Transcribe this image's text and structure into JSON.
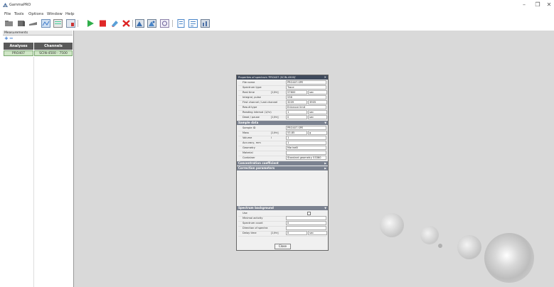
{
  "window": {
    "title": "GammaPRO",
    "controls": [
      "–",
      "❐",
      "✕"
    ]
  },
  "menu": [
    "File",
    "Tools",
    "Options",
    "Window",
    "Help"
  ],
  "toolbar": {
    "icons": [
      "open-folder-icon",
      "library-icon",
      "detector-icon",
      "spectrum-view-icon",
      "spectrum-list-icon",
      "spectrum-edit-icon",
      "start-icon",
      "stop-icon",
      "erase-icon",
      "delete-icon",
      "spectrum-a-icon",
      "spectrum-b-icon",
      "report-icon",
      "document-icon",
      "table-icon",
      "chart-icon"
    ],
    "colors": {
      "start": "#2fae4a",
      "stop": "#e02828",
      "delete": "#d22",
      "accent": "#3a78c9"
    }
  },
  "left_panel": {
    "header": "Measurements",
    "columns": [
      "Analyses",
      "Channels"
    ],
    "rows": [
      {
        "analysis": "PRO407",
        "channels": "SCIN-4500 - 7500"
      }
    ]
  },
  "dialog": {
    "title": "Properties of spectrum 'PRO407 (SCIN-4500)'",
    "close": "✕",
    "sections": {
      "measurement": {
        "rows": [
          {
            "label": "File name",
            "value": "PRO407.SPE"
          },
          {
            "label": "Spectrum type",
            "value": "Trace"
          },
          {
            "label": "Real time",
            "unit": "[1/Hr]",
            "value": "57600",
            "unit2": "sec"
          },
          {
            "label": "Integral, pulse",
            "value": "536"
          },
          {
            "label": "First channel / Last channel",
            "value": "3209",
            "value2": "3905"
          },
          {
            "label": "Result type",
            "value": "Entrance limit"
          },
          {
            "label": "Reading interval (1/hr)",
            "value": "1",
            "unit2": "sec"
          },
          {
            "label": "Dead / pause",
            "unit": "[1/Hr]",
            "value": "0",
            "unit2": "sec"
          }
        ]
      },
      "sample": {
        "title": "Sample data",
        "rows": [
          {
            "label": "Sample ID",
            "value": "PRO407.SPE"
          },
          {
            "label": "Mass",
            "unit": "[1/Hr]",
            "value": "53.85",
            "unit2": "g"
          },
          {
            "label": "Volume",
            "unit": "l",
            "value": "1"
          },
          {
            "label": "Accuracy, mm",
            "value": "1"
          },
          {
            "label": "Geometry",
            "value": "Marinelli"
          },
          {
            "label": "Material",
            "value": ""
          },
          {
            "label": "Container",
            "value": "Standard geometry 53360"
          }
        ]
      },
      "concentration": {
        "title": "Concentration coefficient"
      },
      "correction": {
        "title": "Correction parameters"
      },
      "background": {
        "title": "Spectrum background",
        "rows": [
          {
            "label": "Use",
            "checkbox": true
          },
          {
            "label": "Minimal activity",
            "value": ""
          },
          {
            "label": "Spectrum count",
            "value": "0"
          },
          {
            "label": "Direction of spectra",
            "value": ""
          },
          {
            "label": "Delay time",
            "unit": "[1/Hr]",
            "value": "0",
            "unit2": "sec"
          }
        ]
      }
    },
    "close_button": "Close"
  }
}
